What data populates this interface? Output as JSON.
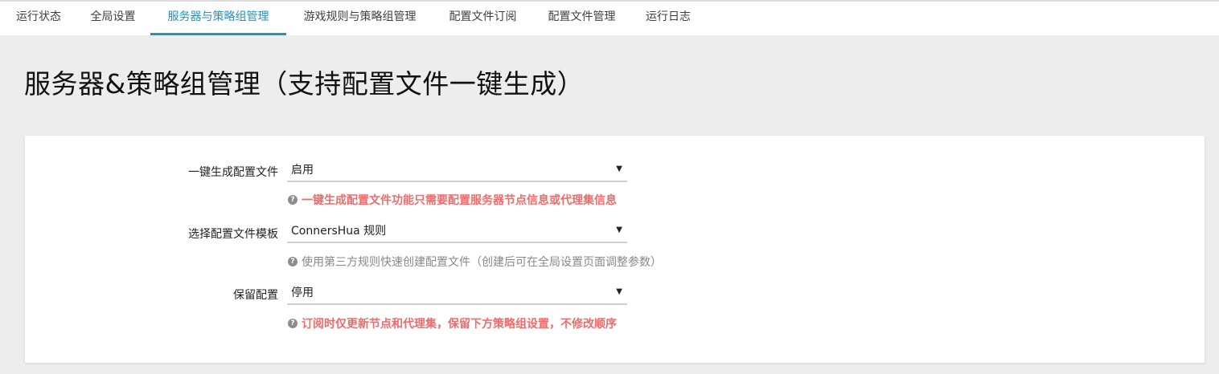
{
  "tabs": [
    {
      "label": "运行状态",
      "active": false
    },
    {
      "label": "全局设置",
      "active": false
    },
    {
      "label": "服务器与策略组管理",
      "active": true
    },
    {
      "label": "游戏规则与策略组管理",
      "active": false
    },
    {
      "label": "配置文件订阅",
      "active": false
    },
    {
      "label": "配置文件管理",
      "active": false
    },
    {
      "label": "运行日志",
      "active": false
    }
  ],
  "colors": {
    "accent": "#1a95c9",
    "warning": "#f06a6a",
    "hint": "#888888"
  },
  "page_title": "服务器&策略组管理（支持配置文件一键生成）",
  "form": {
    "fields": [
      {
        "label": "一键生成配置文件",
        "value": "启用",
        "hint": "一键生成配置文件功能只需要配置服务器节点信息或代理集信息",
        "hint_style": "warning",
        "hint_icon": "question-circle-icon"
      },
      {
        "label": "选择配置文件模板",
        "value": "ConnersHua 规则",
        "hint": "使用第三方规则快速创建配置文件（创建后可在全局设置页面调整参数）",
        "hint_style": "info",
        "hint_icon": "question-circle-icon"
      },
      {
        "label": "保留配置",
        "value": "停用",
        "hint": "订阅时仅更新节点和代理集，保留下方策略组设置，不修改顺序",
        "hint_style": "warning",
        "hint_icon": "question-circle-icon"
      }
    ]
  }
}
